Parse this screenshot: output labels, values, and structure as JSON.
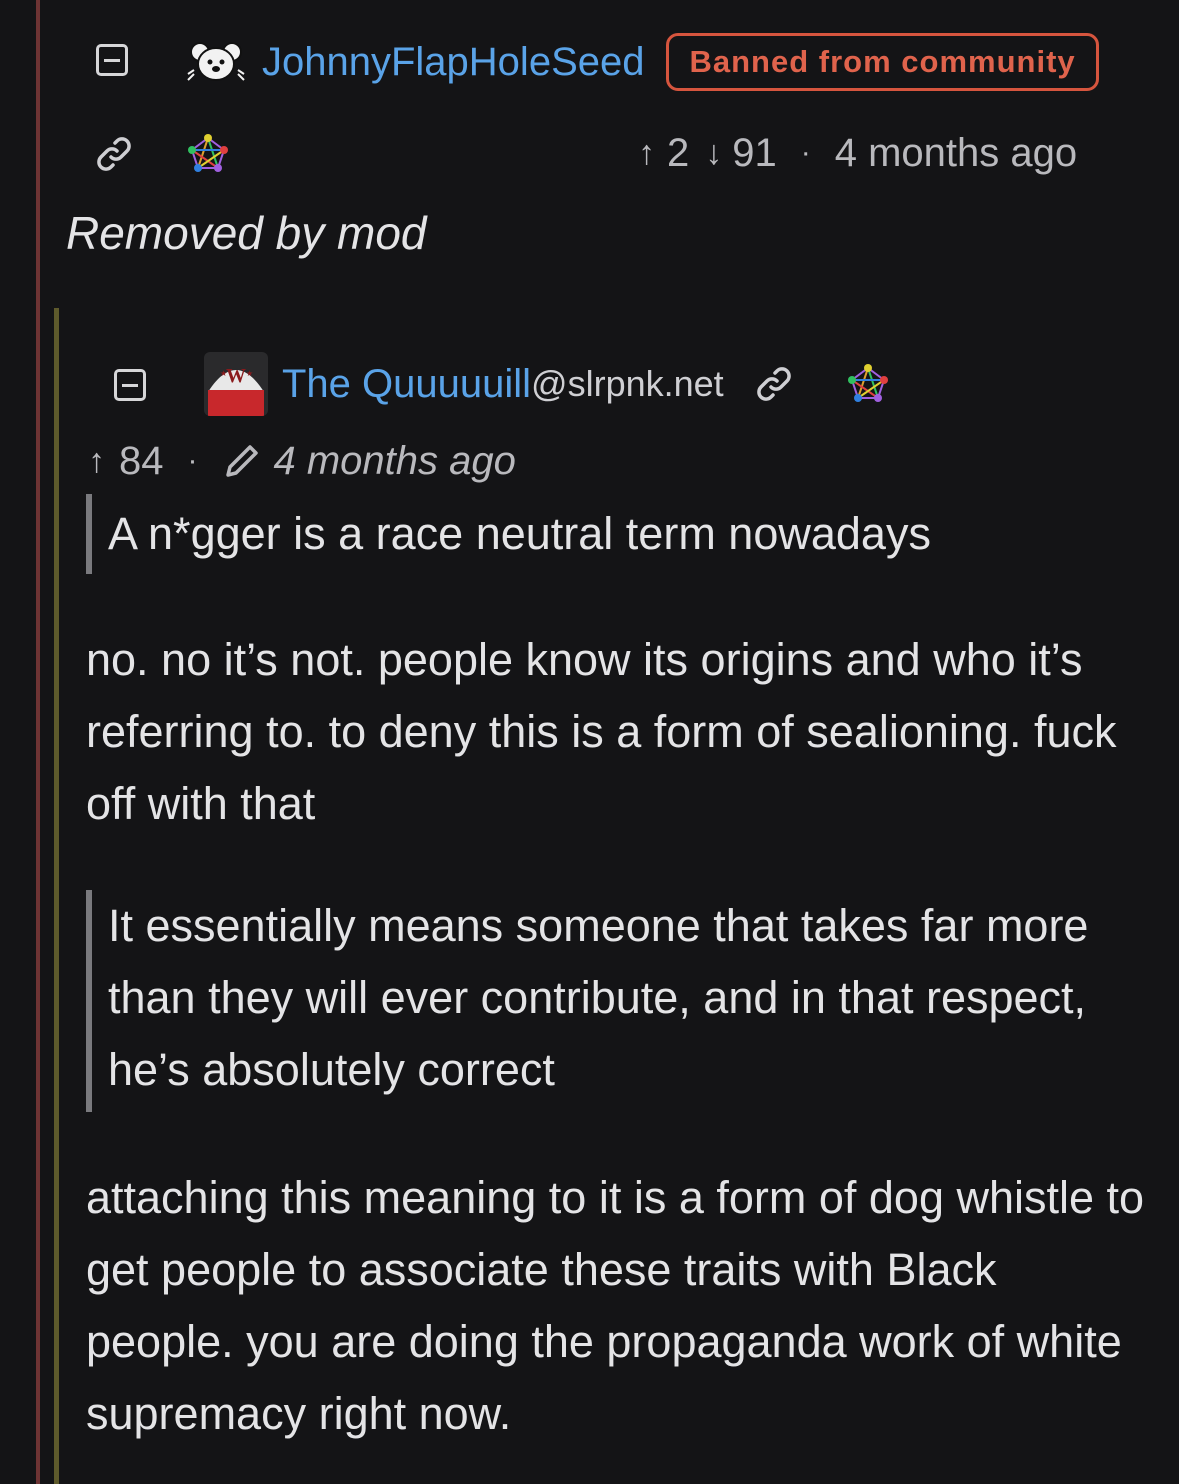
{
  "comment1": {
    "username": "JohnnyFlapHoleSeed",
    "badge": "Banned from community",
    "upvote_count": "2",
    "downvote_count": "91",
    "separator": "·",
    "time": "4 months ago",
    "content": "Removed by mod"
  },
  "comment2": {
    "display_name": "The Quuuuuill",
    "instance": "@slrpnk.net",
    "upvote_count": "84",
    "separator": "·",
    "time": "4 months ago",
    "quote1": "A n*gger is a race neutral term nowadays",
    "paragraph1": "no. no it’s not. people know its origins and who it’s referring to. to deny this is a form of sealioning. fuck off with that",
    "quote2": "It essentially means someone that takes far more than they will ever contribute, and in that respect, he’s absolutely correct",
    "paragraph2": "attaching this meaning to it is a form of dog whistle to get people to associate these traits with Black people. you are doing the propaganda work of white supremacy right now."
  },
  "colors": {
    "background": "#141416",
    "username": "#5aa3e8",
    "banned_badge": "#e0634c",
    "thread_line_level1": "#6e3434",
    "thread_line_level2": "#5e5a2c"
  }
}
